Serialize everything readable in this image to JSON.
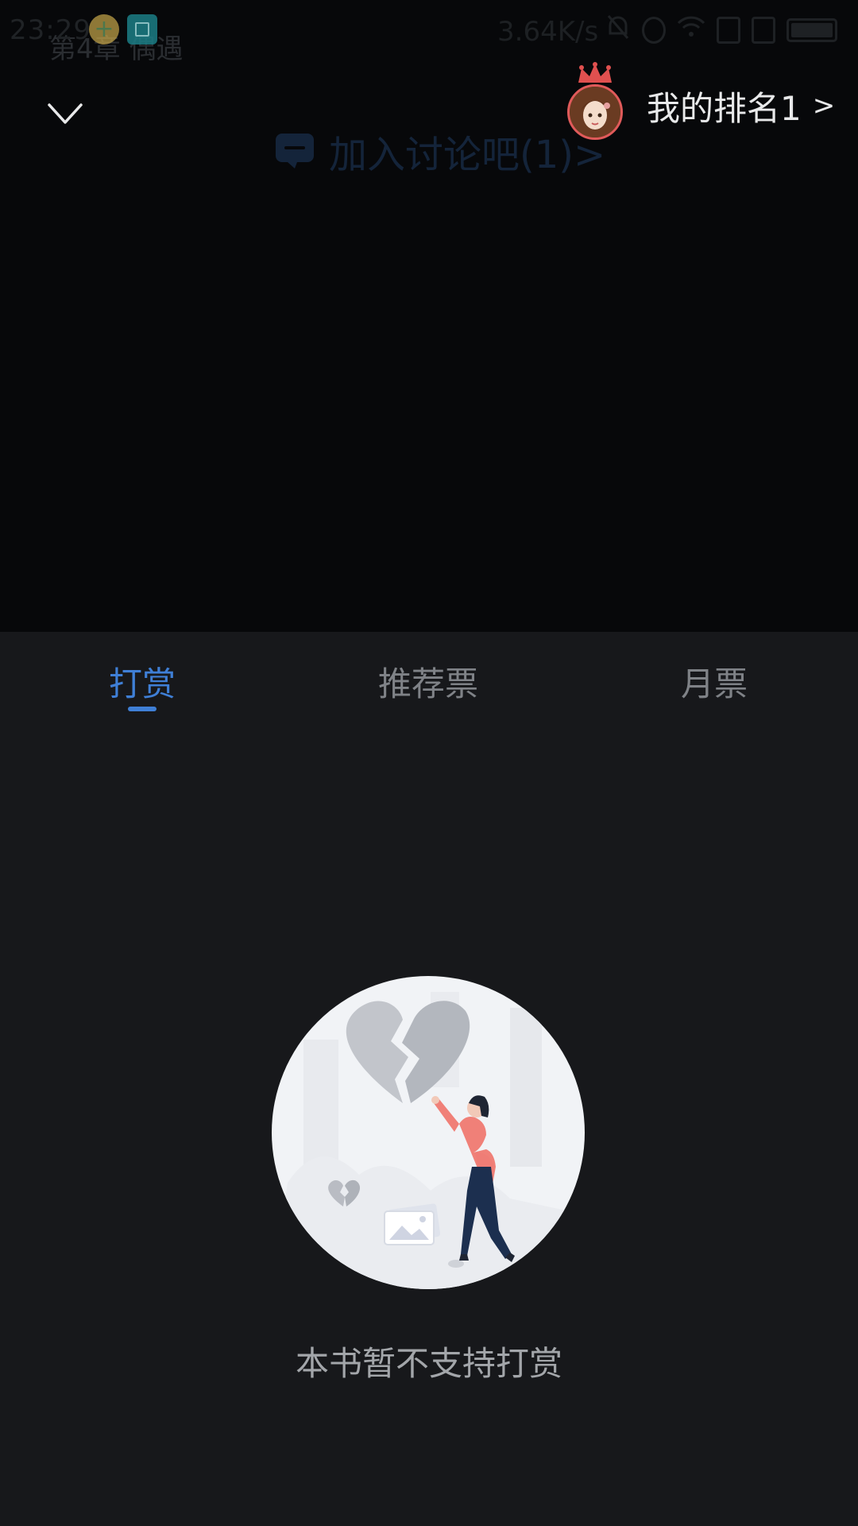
{
  "status_bar": {
    "time": "23:29",
    "net_speed": "3.64K/s",
    "icons": [
      "notification-yellow-icon",
      "screenshot-icon",
      "mute-icon",
      "alarm-icon",
      "wifi-icon",
      "sim1-icon",
      "sim2-icon",
      "battery-icon"
    ]
  },
  "reader": {
    "chapter_title": "第4章  偶遇",
    "discussion_label": "加入讨论吧(1)>"
  },
  "header": {
    "ranking_label": "我的排名1",
    "ranking_arrow": ">",
    "collapse_icon": "chevron-down-icon"
  },
  "tabs": [
    {
      "label": "打赏",
      "active": true
    },
    {
      "label": "推荐票",
      "active": false
    },
    {
      "label": "月票",
      "active": false
    }
  ],
  "empty_state": {
    "message": "本书暂不支持打赏",
    "illustration": "broken-heart-illustration"
  },
  "colors": {
    "accent": "#3f7fd6",
    "sheet_bg": "#17181b",
    "tab_inactive": "#7f8287",
    "empty_text": "#a3a6aa"
  }
}
